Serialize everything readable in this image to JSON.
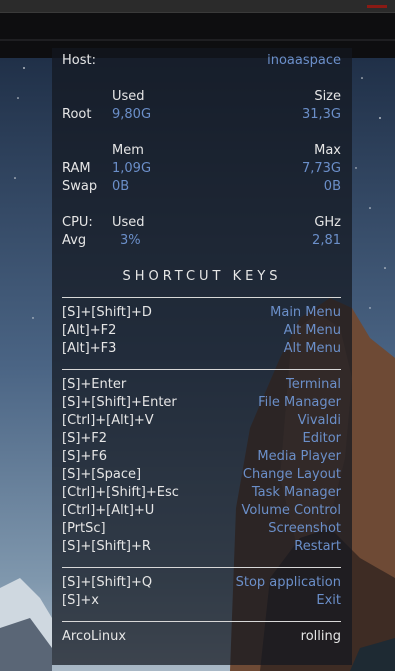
{
  "host": {
    "label": "Host:",
    "value": "inoaaspace"
  },
  "root": {
    "used_header": "Used",
    "size_header": "Size",
    "label": "Root",
    "used": "9,80G",
    "size": "31,3G"
  },
  "memory": {
    "mem_header": "Mem",
    "max_header": "Max",
    "ram_label": "RAM",
    "ram_used": "1,09G",
    "ram_max": "7,73G",
    "swap_label": "Swap",
    "swap_used": "0B",
    "swap_max": "0B"
  },
  "cpu": {
    "label": "CPU:",
    "used_header": "Used",
    "ghz_header": "GHz",
    "avg_label": "Avg",
    "avg_used": "3%",
    "avg_ghz": "2,81"
  },
  "shortcuts_title": "SHORTCUT KEYS",
  "group1": [
    {
      "keys": "[S]+[Shift]+D",
      "action": "Main Menu"
    },
    {
      "keys": "[Alt]+F2",
      "action": "Alt Menu"
    },
    {
      "keys": "[Alt]+F3",
      "action": "Alt Menu"
    }
  ],
  "group2": [
    {
      "keys": "[S]+Enter",
      "action": "Terminal"
    },
    {
      "keys": "[S]+[Shift]+Enter",
      "action": "File Manager"
    },
    {
      "keys": "[Ctrl]+[Alt]+V",
      "action": "Vivaldi"
    },
    {
      "keys": "[S]+F2",
      "action": "Editor"
    },
    {
      "keys": "[S]+F6",
      "action": "Media Player"
    },
    {
      "keys": "[S]+[Space]",
      "action": "Change Layout"
    },
    {
      "keys": "[Ctrl]+[Shift]+Esc",
      "action": "Task Manager"
    },
    {
      "keys": "[Ctrl]+[Alt]+U",
      "action": "Volume Control"
    },
    {
      "keys": "[PrtSc]",
      "action": "Screenshot"
    },
    {
      "keys": "[S]+[Shift]+R",
      "action": "Restart"
    }
  ],
  "group3": [
    {
      "keys": "[S]+[Shift]+Q",
      "action": "Stop application"
    },
    {
      "keys": "[S]+x",
      "action": "Exit"
    }
  ],
  "footer": {
    "distro": "ArcoLinux",
    "release": "rolling"
  },
  "colors": {
    "accent": "#6b8fc9",
    "text": "#e6e6e6"
  }
}
